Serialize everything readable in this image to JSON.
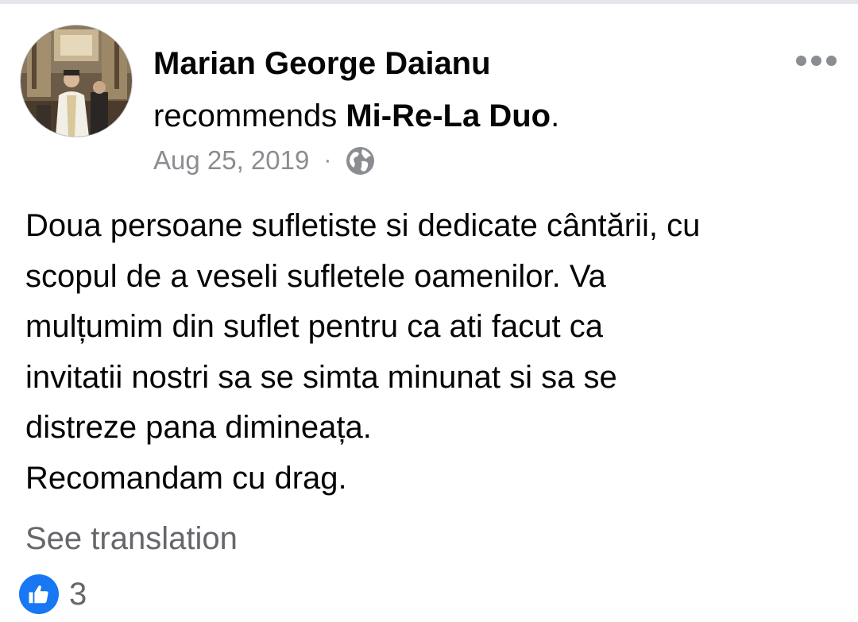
{
  "post": {
    "author": {
      "name": "Marian George Daianu"
    },
    "action": {
      "verb": "recommends",
      "page_name": "Mi-Re-La Duo",
      "suffix": "."
    },
    "meta": {
      "date": "Aug 25, 2019",
      "separator": "·",
      "audience_icon": "globe-icon"
    },
    "body_lines": [
      "Doua persoane sufletiste si dedicate cântării, cu",
      "scopul de a veseli sufletele oamenilor. Va",
      "mulțumim din suflet pentru ca ati facut ca",
      "invitatii nostri sa se simta minunat si sa se",
      "distreze pana dimineața.",
      "Recomandam cu drag."
    ],
    "see_translation_label": "See translation",
    "reactions": {
      "icon": "like-icon",
      "count": "3"
    },
    "more_icon": "more-options-icon"
  },
  "colors": {
    "primary_text": "#050505",
    "secondary_text": "#65676b",
    "meta_text": "#8a8d91",
    "like_blue": "#1877f2",
    "divider": "#e4e6eb"
  }
}
